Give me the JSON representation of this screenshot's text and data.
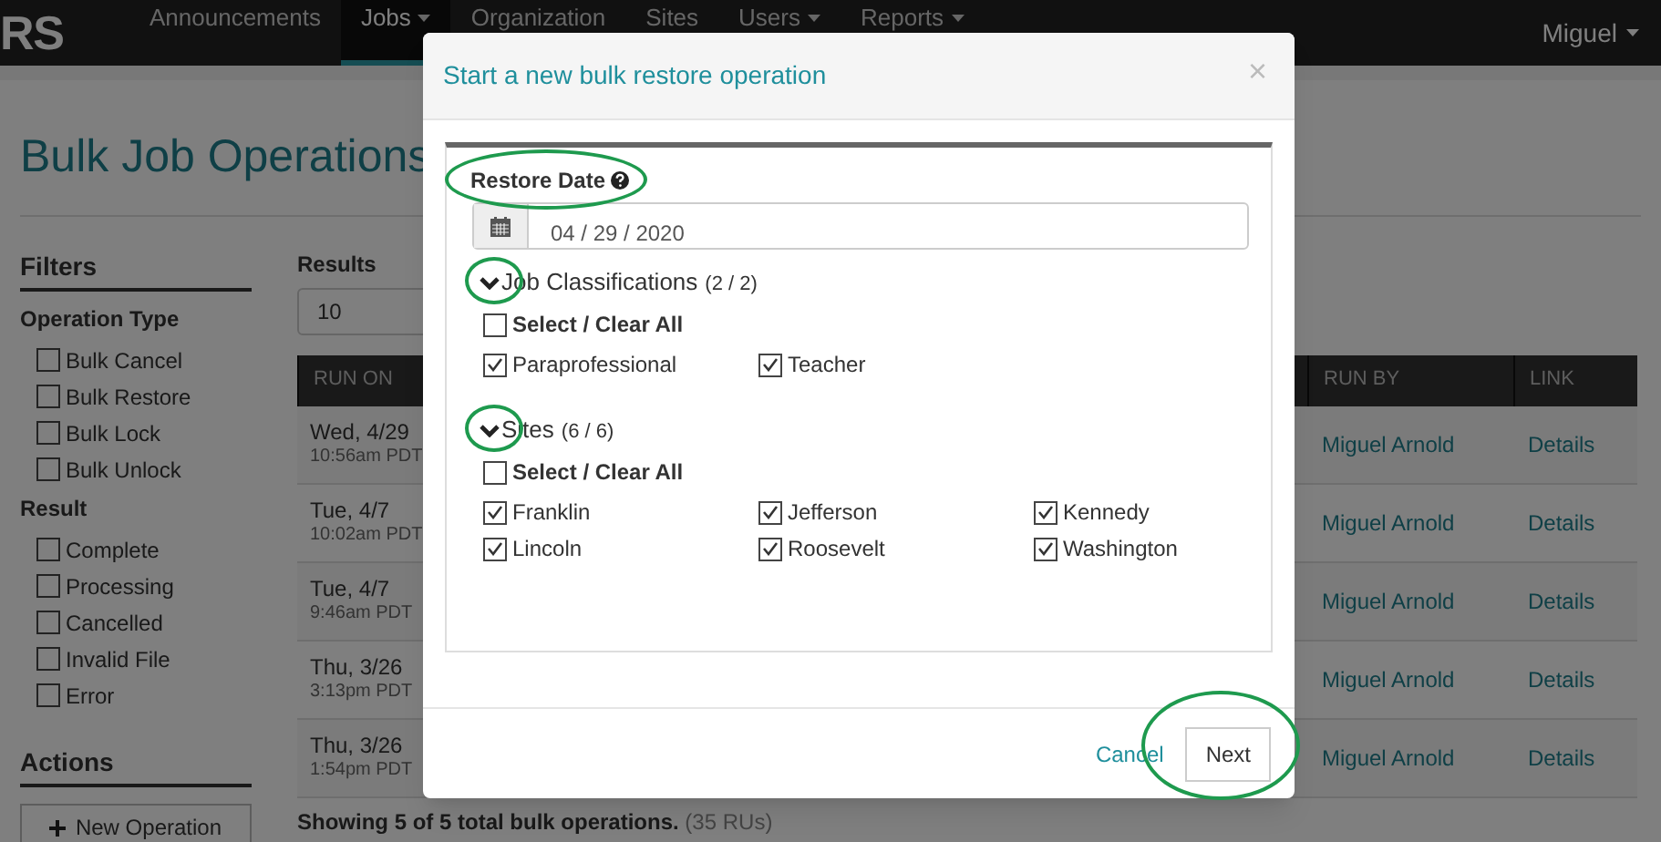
{
  "navbar": {
    "logo": "RS",
    "items": [
      {
        "label": "Announcements",
        "dropdown": false,
        "selected": false
      },
      {
        "label": "Jobs",
        "dropdown": true,
        "selected": true
      },
      {
        "label": "Organization",
        "dropdown": false,
        "selected": false
      },
      {
        "label": "Sites",
        "dropdown": false,
        "selected": false
      },
      {
        "label": "Users",
        "dropdown": true,
        "selected": false
      },
      {
        "label": "Reports",
        "dropdown": true,
        "selected": false
      }
    ],
    "user": "Miguel"
  },
  "page": {
    "title": "Bulk Job Operations"
  },
  "filters": {
    "title": "Filters",
    "groups": [
      {
        "title": "Operation Type",
        "options": [
          {
            "label": "Bulk Cancel",
            "checked": false
          },
          {
            "label": "Bulk Restore",
            "checked": false
          },
          {
            "label": "Bulk Lock",
            "checked": false
          },
          {
            "label": "Bulk Unlock",
            "checked": false
          }
        ]
      },
      {
        "title": "Result",
        "options": [
          {
            "label": "Complete",
            "checked": false
          },
          {
            "label": "Processing",
            "checked": false
          },
          {
            "label": "Cancelled",
            "checked": false
          },
          {
            "label": "Invalid File",
            "checked": false
          },
          {
            "label": "Error",
            "checked": false
          }
        ]
      }
    ]
  },
  "actions": {
    "title": "Actions",
    "buttons": [
      "New Operation"
    ]
  },
  "results": {
    "label": "Results",
    "value": "10"
  },
  "table": {
    "columns": [
      "RUN ON",
      "RUN BY",
      "LINK"
    ],
    "rows": [
      {
        "date": "Wed, 4/29",
        "time": "10:56am PDT",
        "run_by": "Miguel Arnold",
        "link": "Details"
      },
      {
        "date": "Tue, 4/7",
        "time": "10:02am PDT",
        "run_by": "Miguel Arnold",
        "link": "Details"
      },
      {
        "date": "Tue, 4/7",
        "time": "9:46am PDT",
        "run_by": "Miguel Arnold",
        "link": "Details"
      },
      {
        "date": "Thu, 3/26",
        "time": "3:13pm PDT",
        "run_by": "Miguel Arnold",
        "link": "Details"
      },
      {
        "date": "Thu, 3/26",
        "time": "1:54pm PDT",
        "run_by": "Miguel Arnold",
        "link": "Details"
      }
    ]
  },
  "summary": {
    "text": "Showing 5 of 5 total bulk operations.",
    "note": "(35 RUs)"
  },
  "modal": {
    "title": "Start a new bulk restore operation",
    "close": "×",
    "restore_date": {
      "label": "Restore Date",
      "highlighted": true,
      "value": "04 / 29 / 2020"
    },
    "sections": [
      {
        "title": "Job Classifications",
        "count": "(2 / 2)",
        "expanded": true,
        "highlighted": true,
        "select_all": {
          "label": "Select / Clear All",
          "checked": false
        },
        "options": [
          {
            "label": "Paraprofessional",
            "checked": true
          },
          {
            "label": "Teacher",
            "checked": true
          }
        ]
      },
      {
        "title": "Sites",
        "count": "(6 / 6)",
        "expanded": true,
        "highlighted": true,
        "select_all": {
          "label": "Select / Clear All",
          "checked": false
        },
        "options": [
          {
            "label": "Franklin",
            "checked": true
          },
          {
            "label": "Jefferson",
            "checked": true
          },
          {
            "label": "Kennedy",
            "checked": true
          },
          {
            "label": "Lincoln",
            "checked": true
          },
          {
            "label": "Roosevelt",
            "checked": true
          },
          {
            "label": "Washington",
            "checked": true
          }
        ]
      }
    ],
    "cancel": "Cancel",
    "next": {
      "label": "Next",
      "highlighted": true
    }
  }
}
